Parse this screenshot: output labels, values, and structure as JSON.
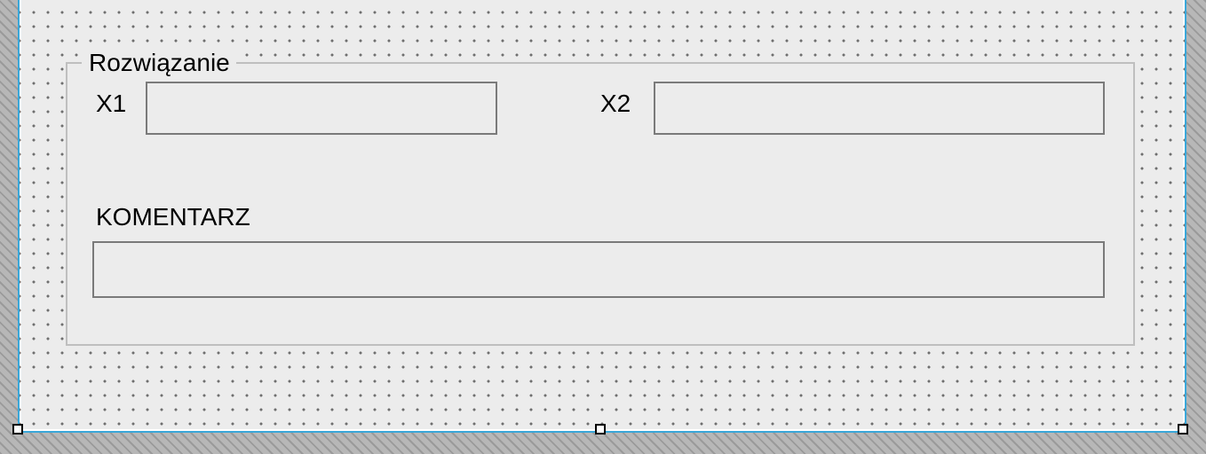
{
  "groupbox": {
    "legend": "Rozwiązanie"
  },
  "fields": {
    "x1": {
      "label": "X1",
      "value": ""
    },
    "x2": {
      "label": "X2",
      "value": ""
    },
    "comment": {
      "label": "KOMENTARZ",
      "value": ""
    }
  }
}
